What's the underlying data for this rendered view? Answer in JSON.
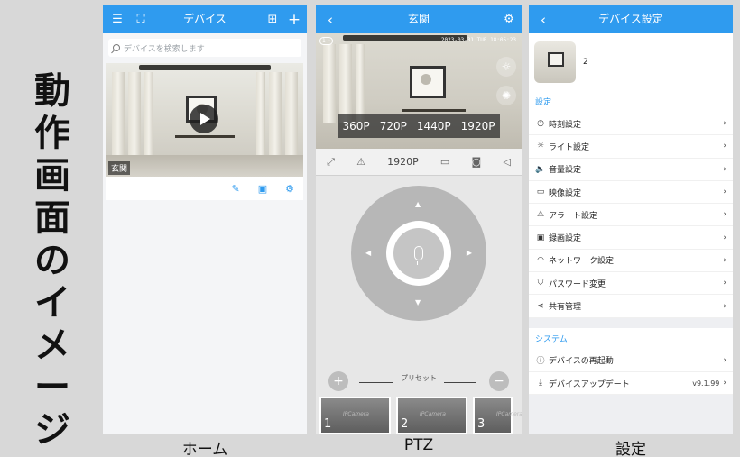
{
  "side_title": [
    "動",
    "作",
    "画",
    "面",
    "の",
    "イ",
    "メ",
    "ー",
    "ジ"
  ],
  "captions": {
    "home": "ホーム",
    "ptz": "PTZ",
    "settings": "設定"
  },
  "home": {
    "title": "デバイス",
    "search_placeholder": "デバイスを検索します",
    "camera_name": "玄関"
  },
  "ptz": {
    "title": "玄関",
    "osd_time": "2023-03-31 TUE 18:05:23",
    "resolutions": [
      "360P",
      "720P",
      "1440P",
      "1920P"
    ],
    "current_resolution": "1920P",
    "preset_label": "プリセット",
    "presets": [
      "1",
      "2",
      "3"
    ],
    "watermark": "IPCamera"
  },
  "settings": {
    "title": "デバイス設定",
    "device_name": "2",
    "section_settings": "設定",
    "items": [
      {
        "icon": "clock-icon",
        "glyph": "◷",
        "label": "時刻設定"
      },
      {
        "icon": "light-icon",
        "glyph": "☼",
        "label": "ライト設定"
      },
      {
        "icon": "speaker-icon",
        "glyph": "🔈",
        "label": "音量設定"
      },
      {
        "icon": "video-icon",
        "glyph": "▭",
        "label": "映像設定"
      },
      {
        "icon": "alert-icon",
        "glyph": "⚠",
        "label": "アラート設定"
      },
      {
        "icon": "record-icon",
        "glyph": "▣",
        "label": "録画設定"
      },
      {
        "icon": "wifi-icon",
        "glyph": "◠",
        "label": "ネットワーク設定"
      },
      {
        "icon": "shield-icon",
        "glyph": "⛉",
        "label": "パスワード変更"
      },
      {
        "icon": "share-icon",
        "glyph": "⋖",
        "label": "共有管理"
      }
    ],
    "section_system": "システム",
    "system_items": [
      {
        "icon": "restart-icon",
        "glyph": "ⓘ",
        "label": "デバイスの再起動",
        "value": ""
      },
      {
        "icon": "download-icon",
        "glyph": "⤓",
        "label": "デバイスアップデート",
        "value": "v9.1.99"
      }
    ]
  }
}
